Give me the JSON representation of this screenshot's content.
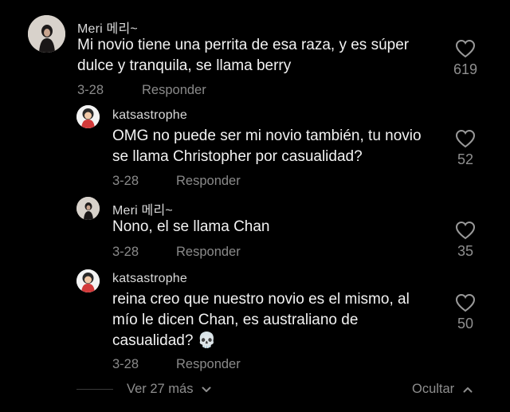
{
  "comments": [
    {
      "username": "Meri 메리~",
      "text": "Mi novio tiene una perrita de esa raza, y es súper dulce y tranquila, se llama berry",
      "date": "3-28",
      "reply_label": "Responder",
      "likes": "619",
      "avatar_icon": "profile-photo"
    },
    {
      "username": "katsastrophe",
      "text": "OMG no puede ser mi novio también, tu novio se llama Christopher por casualidad?",
      "date": "3-28",
      "reply_label": "Responder",
      "likes": "52",
      "avatar_icon": "cartoon-avatar"
    },
    {
      "username": "Meri 메리~",
      "text": "Nono, el se llama Chan",
      "date": "3-28",
      "reply_label": "Responder",
      "likes": "35",
      "avatar_icon": "profile-photo"
    },
    {
      "username": "katsastrophe",
      "text": "reina creo que nuestro novio es el mismo, al mío le dicen Chan, es australiano de casualidad? 💀",
      "date": "3-28",
      "reply_label": "Responder",
      "likes": "50",
      "avatar_icon": "cartoon-avatar"
    }
  ],
  "footer": {
    "view_more_label": "Ver 27 más",
    "hide_label": "Ocultar"
  }
}
